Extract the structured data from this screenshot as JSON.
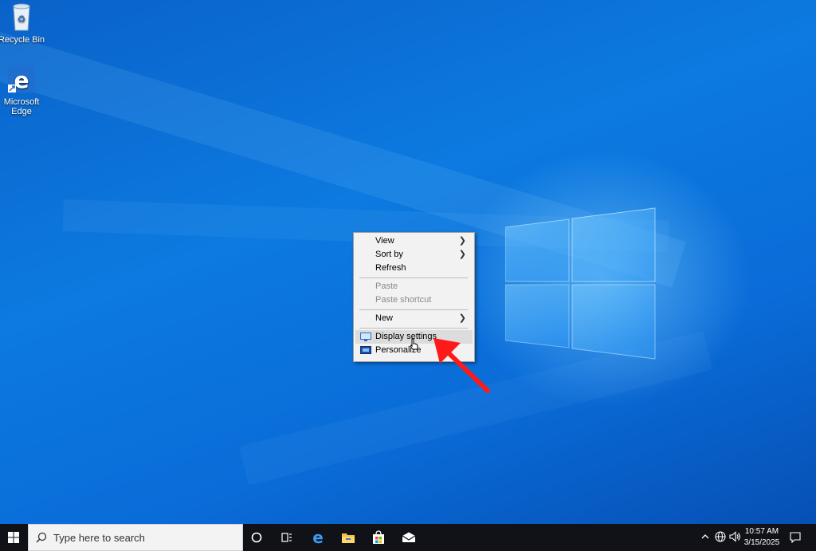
{
  "desktop": {
    "icons": [
      {
        "label": "Recycle Bin",
        "icon": "recycle-bin-icon"
      },
      {
        "label": "Microsoft Edge",
        "icon": "edge-icon"
      }
    ]
  },
  "context_menu": {
    "items": [
      {
        "label": "View",
        "submenu": true
      },
      {
        "label": "Sort by",
        "submenu": true
      },
      {
        "label": "Refresh"
      },
      {
        "label": "Paste",
        "disabled": true
      },
      {
        "label": "Paste shortcut",
        "disabled": true
      },
      {
        "label": "New",
        "submenu": true
      },
      {
        "label": "Display settings",
        "icon": "display-settings-icon",
        "hovered": true
      },
      {
        "label": "Personalize",
        "icon": "personalize-icon"
      }
    ]
  },
  "annotation": {
    "arrow_color": "#ff1a1a"
  },
  "taskbar": {
    "search_placeholder": "Type here to search",
    "apps": [
      "cortana-icon",
      "task-view-icon",
      "edge-icon",
      "file-explorer-icon",
      "store-icon",
      "mail-icon"
    ],
    "tray": {
      "time": "10:57 AM",
      "date": "3/15/2025"
    }
  },
  "colors": {
    "accent": "#0a6cd8",
    "taskbar": "#101217",
    "menu_bg": "#f2f2f2"
  }
}
